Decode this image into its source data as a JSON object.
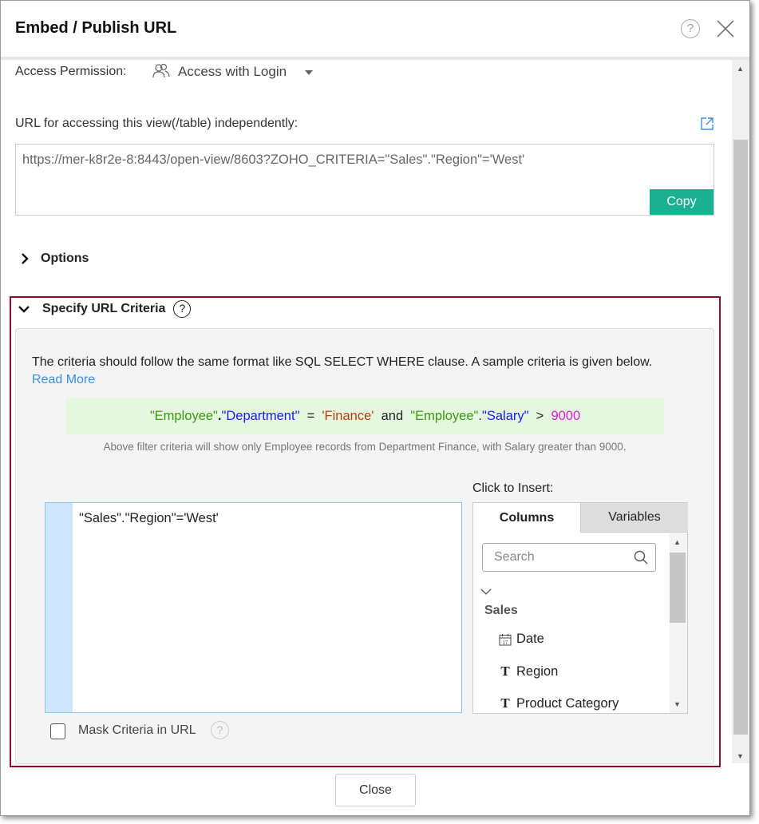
{
  "header": {
    "title": "Embed / Publish URL",
    "help_glyph": "?"
  },
  "access": {
    "label": "Access Permission:",
    "value": "Access with Login"
  },
  "url": {
    "label": "URL for accessing this view(/table) independently:",
    "value": "https://mer-k8r2e-8:8443/open-view/8603?ZOHO_CRITERIA=\"Sales\".\"Region\"='West'",
    "copy_label": "Copy"
  },
  "options": {
    "label": "Options"
  },
  "criteria": {
    "label": "Specify URL Criteria",
    "help_glyph": "?",
    "description": "The criteria should follow the same format like SQL SELECT WHERE clause. A sample criteria is given below.",
    "read_more": "Read More",
    "sample": {
      "t1": "\"Employee\"",
      "t2": ".",
      "t3": "\"Department\"",
      "t4": "=",
      "t5": "'Finance'",
      "t6": "and",
      "t7": "\"Employee\"",
      "t8": ".",
      "t9": "\"Salary\"",
      "t10": ">",
      "t11": "9000"
    },
    "note": "Above filter criteria will show only Employee records from Department Finance, with Salary greater than 9000.",
    "editor_value": "\"Sales\".\"Region\"='West'",
    "insert_label": "Click to Insert:",
    "tabs": {
      "columns": "Columns",
      "variables": "Variables"
    },
    "search_placeholder": "Search",
    "group": "Sales",
    "columns": [
      {
        "name": "Date",
        "type": "date"
      },
      {
        "name": "Region",
        "type": "text"
      },
      {
        "name": "Product Category",
        "type": "text"
      }
    ],
    "mask_label": "Mask Criteria in URL",
    "mask_checked": false
  },
  "footer": {
    "close_label": "Close"
  },
  "colors": {
    "copy": "#1bb092",
    "highlight_border": "#8b0f24",
    "link": "#3a8ee6"
  }
}
